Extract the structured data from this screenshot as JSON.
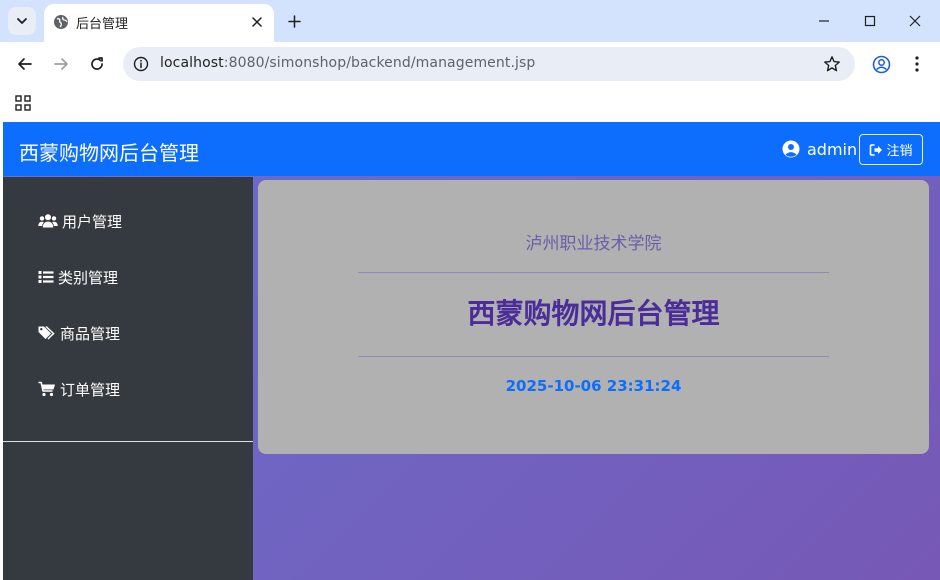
{
  "browser": {
    "tab_title": "后台管理",
    "url_host": "localhost",
    "url_rest": ":8080/simonshop/backend/management.jsp"
  },
  "navbar": {
    "brand": "西蒙购物网后台管理",
    "username": "admin",
    "logout_label": "注销"
  },
  "sidebar": {
    "items": [
      {
        "label": "用户管理",
        "icon": "users-icon"
      },
      {
        "label": "类别管理",
        "icon": "list-icon"
      },
      {
        "label": "商品管理",
        "icon": "tags-icon"
      },
      {
        "label": "订单管理",
        "icon": "cart-icon"
      }
    ]
  },
  "main": {
    "college": "泸州职业技术学院",
    "title": "西蒙购物网后台管理",
    "datetime": "2025-10-06 23:31:24"
  },
  "colors": {
    "navbar": "#0d6efd",
    "sidebar": "#343a40",
    "title": "#4b2d9a",
    "clock": "#0d6efd"
  }
}
